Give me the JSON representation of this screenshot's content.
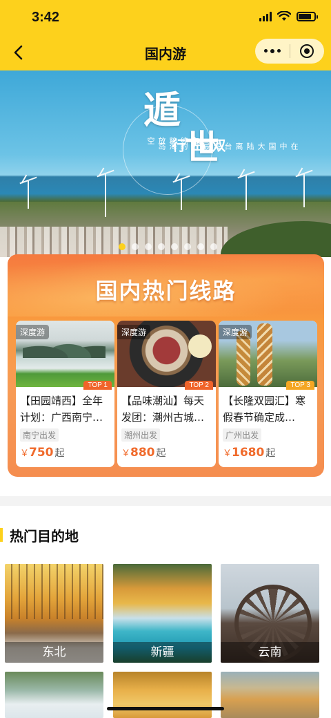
{
  "status_bar": {
    "time": "3:42",
    "signal_level": 1.0,
    "battery_level": 0.8
  },
  "nav": {
    "title": "国内游",
    "back_icon": "chevron-left-icon",
    "more_icon": "more-dots-icon",
    "close_icon": "target-icon"
  },
  "banner": {
    "title_char_1": "遁",
    "title_char_2": "世",
    "subtitle": "双岛行",
    "tagline_left": "去纯粹放空",
    "tagline_right": "在中国大陆离台湾最近的海岛",
    "indicator_count": 8,
    "active_index": 0
  },
  "hot_routes": {
    "title": "国内热门线路",
    "items": [
      {
        "tag": "深度游",
        "rank": "TOP 1",
        "name": "【田园靖西】全年计划：广西南宁…",
        "depart": "南宁出发",
        "currency": "￥",
        "price": "750",
        "suffix": "起",
        "rank_color": "#f0642a"
      },
      {
        "tag": "深度游",
        "rank": "TOP 2",
        "name": "【品味潮汕】每天发团：潮州古城…",
        "depart": "潮州出发",
        "currency": "￥",
        "price": "880",
        "suffix": "起",
        "rank_color": "#f0642a"
      },
      {
        "tag": "深度游",
        "rank": "TOP 3",
        "name": "【长隆双园汇】寒假春节确定成…",
        "depart": "广州出发",
        "currency": "￥",
        "price": "1680",
        "suffix": "起",
        "rank_color": "#f5a623"
      }
    ]
  },
  "destinations": {
    "title": "热门目的地",
    "items": [
      {
        "label": "东北"
      },
      {
        "label": "新疆"
      },
      {
        "label": "云南"
      }
    ]
  },
  "colors": {
    "brand_yellow": "#fdd11c",
    "price_orange": "#f06a2b",
    "routes_bg": "#f99a3e"
  }
}
